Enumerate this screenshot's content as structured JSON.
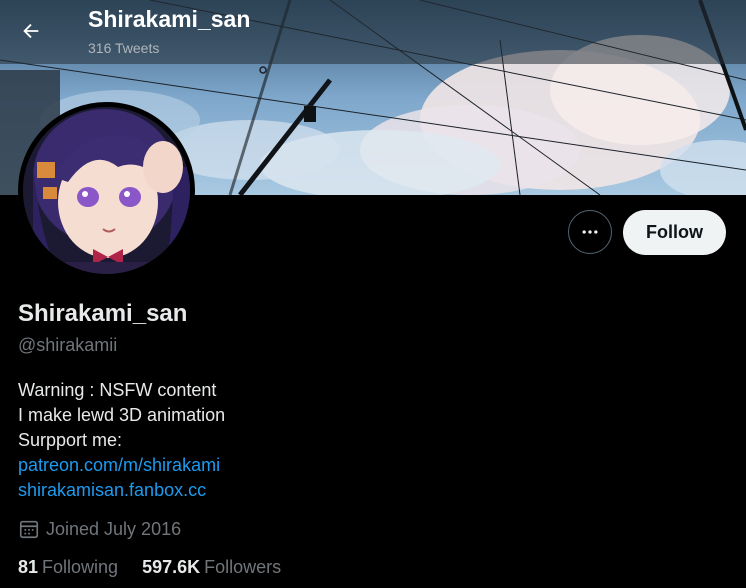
{
  "header": {
    "name": "Shirakami_san",
    "tweet_count": "316 Tweets"
  },
  "profile": {
    "display_name": "Shirakami_san",
    "handle": "@shirakamii",
    "bio_lines": [
      "Warning : NSFW content",
      "I make lewd 3D animation",
      "Surpport me:"
    ],
    "links": [
      "patreon.com/m/shirakami",
      "shirakamisan.fanbox.cc"
    ],
    "joined": "Joined July 2016",
    "following_count": "81",
    "following_label": "Following",
    "followers_count": "597.6K",
    "followers_label": "Followers"
  },
  "actions": {
    "follow_label": "Follow"
  },
  "icons": {
    "back": "arrow-left-icon",
    "more": "more-horizontal-icon",
    "calendar": "calendar-icon"
  },
  "colors": {
    "background": "#000000",
    "link": "#1d9bf0",
    "secondary_text": "#71767b",
    "follow_button_bg": "#eff3f4"
  }
}
